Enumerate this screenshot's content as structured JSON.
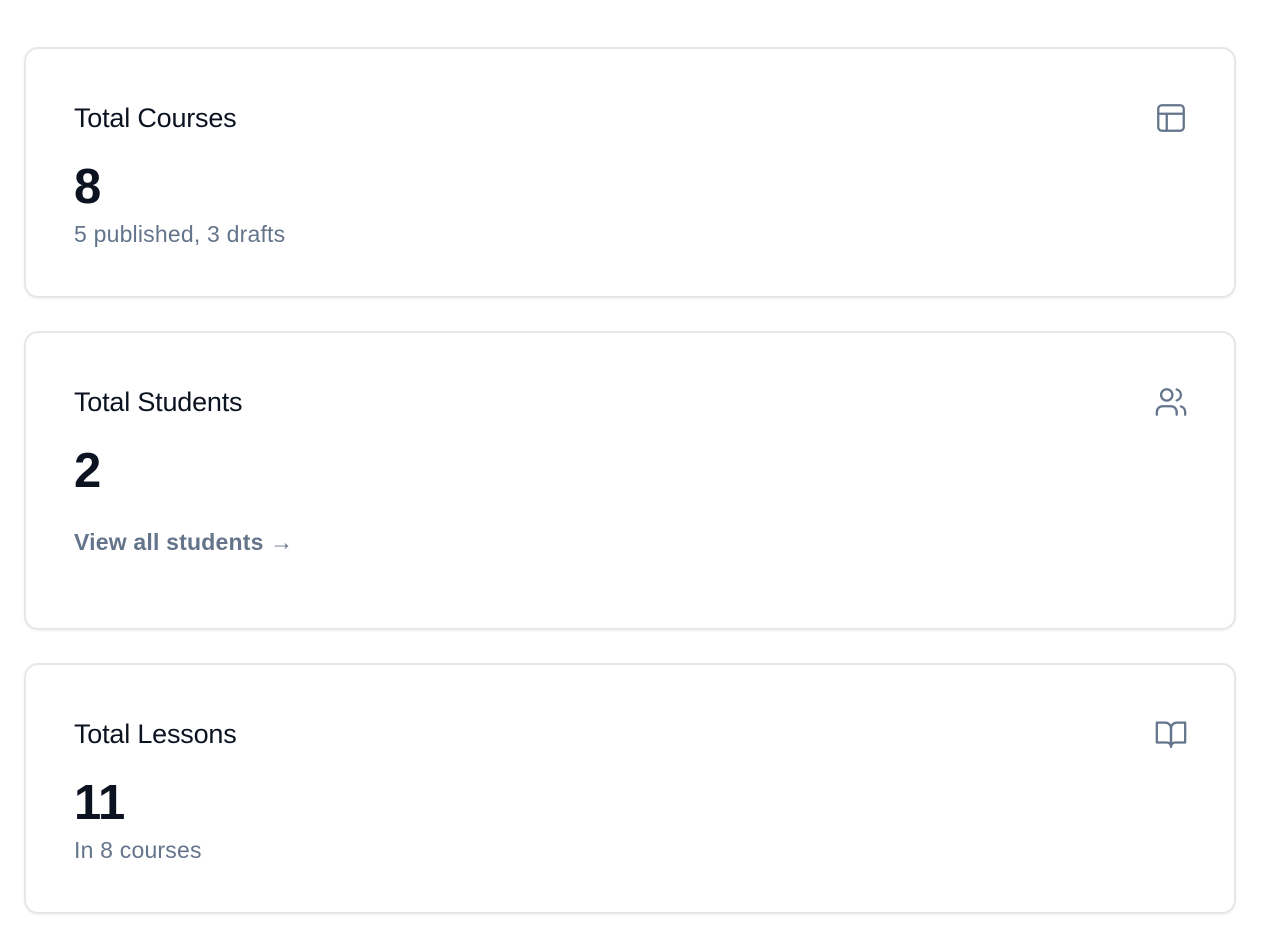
{
  "stats": {
    "courses": {
      "title": "Total Courses",
      "value": "8",
      "subtitle": "5 published, 3 drafts",
      "icon": "layout-icon"
    },
    "students": {
      "title": "Total Students",
      "value": "2",
      "link_label": "View all students →",
      "icon": "users-icon"
    },
    "lessons": {
      "title": "Total Lessons",
      "value": "11",
      "subtitle": "In 8 courses",
      "icon": "book-open-icon"
    }
  },
  "colors": {
    "text_primary": "#0b1220",
    "text_muted": "#64748b",
    "card_border": "#e5e7eb",
    "background": "#ffffff"
  }
}
